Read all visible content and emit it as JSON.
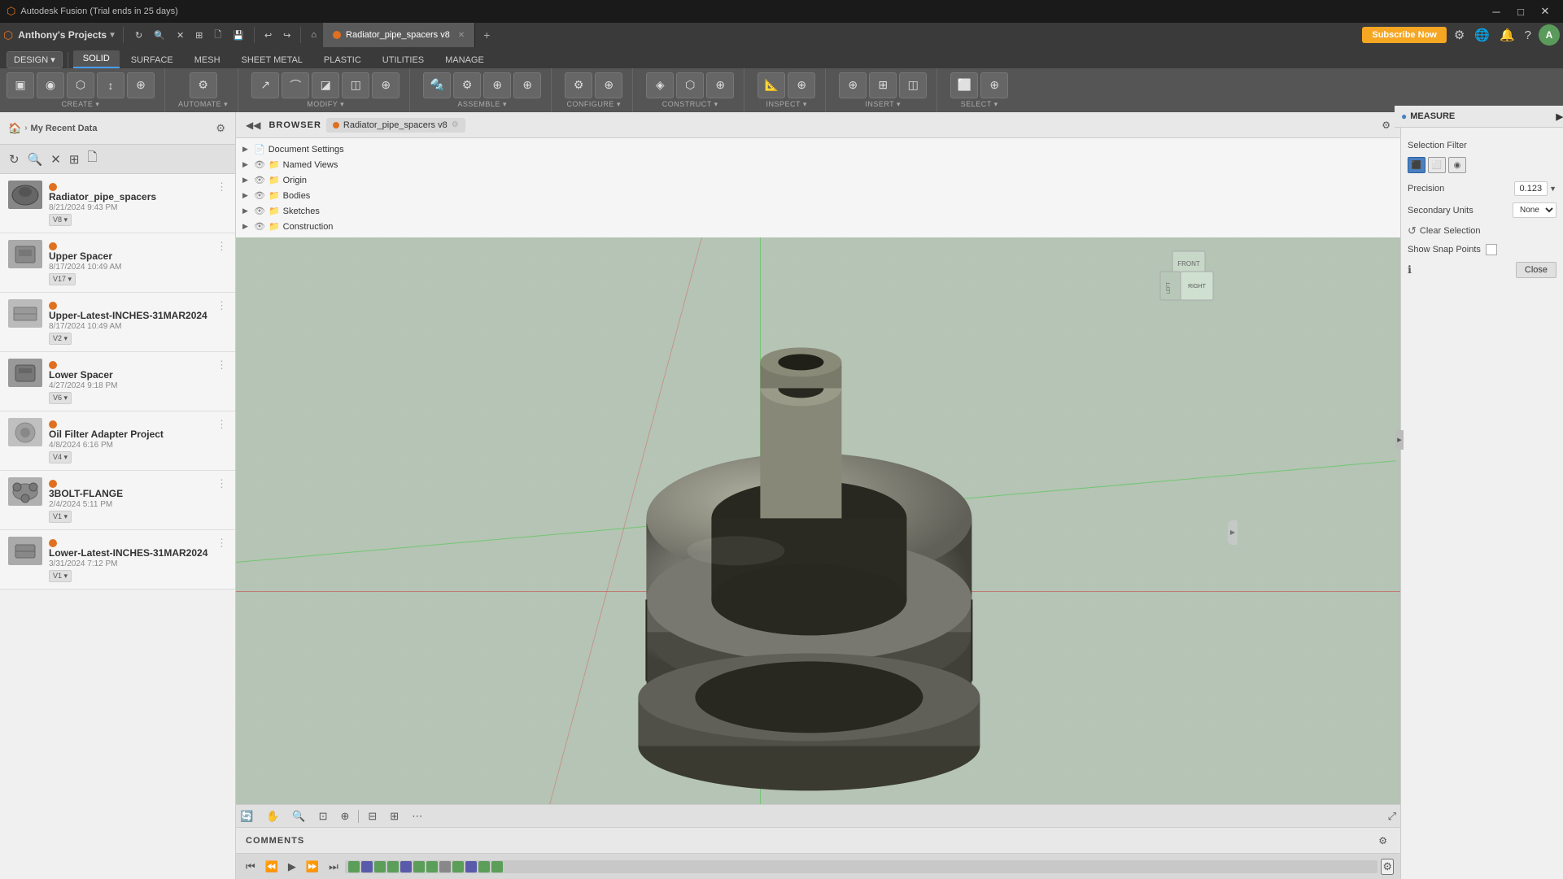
{
  "titlebar": {
    "app_name": "Autodesk Fusion (Trial ends in 25 days)",
    "min_label": "─",
    "max_label": "□",
    "close_label": "✕"
  },
  "header": {
    "projects_title": "Anthony's Projects",
    "subscribe_label": "Subscribe Now",
    "file_label": "Radiator_pipe_spacers v8",
    "close_tab_label": "✕",
    "add_tab_label": "+"
  },
  "toolbar": {
    "undo_label": "↩",
    "redo_label": "↪",
    "save_label": "⊟",
    "home_label": "⌂",
    "refresh_label": "↻",
    "search_label": "🔍",
    "close_label": "✕",
    "grid_label": "⊞",
    "apps_label": "⊞"
  },
  "ribbon": {
    "tabs": [
      "SOLID",
      "SURFACE",
      "MESH",
      "SHEET METAL",
      "PLASTIC",
      "UTILITIES",
      "MANAGE"
    ],
    "active_tab": "SOLID",
    "design_label": "DESIGN",
    "groups": [
      {
        "label": "CREATE",
        "tools": [
          "▣",
          "◉",
          "⬡",
          "↕",
          "⬛"
        ]
      },
      {
        "label": "AUTOMATE",
        "tools": [
          "⚙",
          "⟳"
        ]
      },
      {
        "label": "MODIFY",
        "tools": [
          "↗",
          "✂",
          "⚙",
          "↔"
        ]
      },
      {
        "label": "ASSEMBLE",
        "tools": [
          "🔩",
          "⚙",
          "⊕",
          "↕"
        ]
      },
      {
        "label": "CONFIGURE",
        "tools": [
          "⚙",
          "⊕"
        ]
      },
      {
        "label": "CONSTRUCT",
        "tools": [
          "◈",
          "⬡",
          "⊕"
        ]
      },
      {
        "label": "INSPECT",
        "tools": [
          "📐",
          "⊕"
        ]
      },
      {
        "label": "INSERT",
        "tools": [
          "⊕",
          "⊞",
          "◫"
        ]
      },
      {
        "label": "SELECT",
        "tools": [
          "⬜",
          "⊕"
        ]
      }
    ]
  },
  "browser": {
    "label": "BROWSER",
    "file_name": "Radiator_pipe_spacers v8",
    "tree_items": [
      {
        "name": "Document Settings",
        "indent": 1,
        "has_arrow": true,
        "arrow": "▶"
      },
      {
        "name": "Named Views",
        "indent": 1,
        "has_arrow": true,
        "arrow": "▶"
      },
      {
        "name": "Origin",
        "indent": 1,
        "has_arrow": true,
        "arrow": "▶"
      },
      {
        "name": "Bodies",
        "indent": 1,
        "has_arrow": true,
        "arrow": "▶"
      },
      {
        "name": "Sketches",
        "indent": 1,
        "has_arrow": true,
        "arrow": "▶"
      },
      {
        "name": "Construction",
        "indent": 1,
        "has_arrow": true,
        "arrow": "▶"
      }
    ]
  },
  "projects": [
    {
      "name": "Radiator_pipe_spacers",
      "date": "8/21/2024 9:43 PM",
      "version": "V8",
      "has_thumb": true,
      "thumb_color": "#888"
    },
    {
      "name": "Upper Spacer",
      "date": "8/17/2024 10:49 AM",
      "version": "V17",
      "has_thumb": true,
      "thumb_color": "#aaa"
    },
    {
      "name": "Upper-Latest-INCHES-31MAR2024",
      "date": "8/17/2024 10:49 AM",
      "version": "V2",
      "has_thumb": true,
      "thumb_color": "#bbb"
    },
    {
      "name": "Lower Spacer",
      "date": "4/27/2024 9:18 PM",
      "version": "V6",
      "has_thumb": true,
      "thumb_color": "#999"
    },
    {
      "name": "Oil Filter Adapter Project",
      "date": "4/8/2024 6:16 PM",
      "version": "V4",
      "has_thumb": true,
      "thumb_color": "#c0c0c0"
    },
    {
      "name": "3BOLT-FLANGE",
      "date": "2/4/2024 5:11 PM",
      "version": "V1",
      "has_thumb": true,
      "thumb_color": "#b0b0b0"
    },
    {
      "name": "Lower-Latest-INCHES-31MAR2024",
      "date": "3/31/2024 7:12 PM",
      "version": "V1",
      "has_thumb": true,
      "thumb_color": "#aaa"
    }
  ],
  "measure_panel": {
    "title": "MEASURE",
    "selection_filter_label": "Selection Filter",
    "precision_label": "Precision",
    "precision_value": "0.123",
    "secondary_units_label": "Secondary Units",
    "secondary_units_value": "None",
    "clear_selection_label": "Clear Selection",
    "show_snap_points_label": "Show Snap Points",
    "close_label": "Close"
  },
  "comments": {
    "label": "COMMENTS"
  },
  "timeline": {
    "play_back_label": "⏮",
    "prev_label": "⏪",
    "play_label": "▶",
    "next_label": "⏩",
    "play_end_label": "⏭"
  },
  "viewport": {
    "bottom_tools": [
      "⊕",
      "⊟",
      "⊡",
      "↻",
      "⊕",
      "⊞",
      "⊞"
    ]
  }
}
